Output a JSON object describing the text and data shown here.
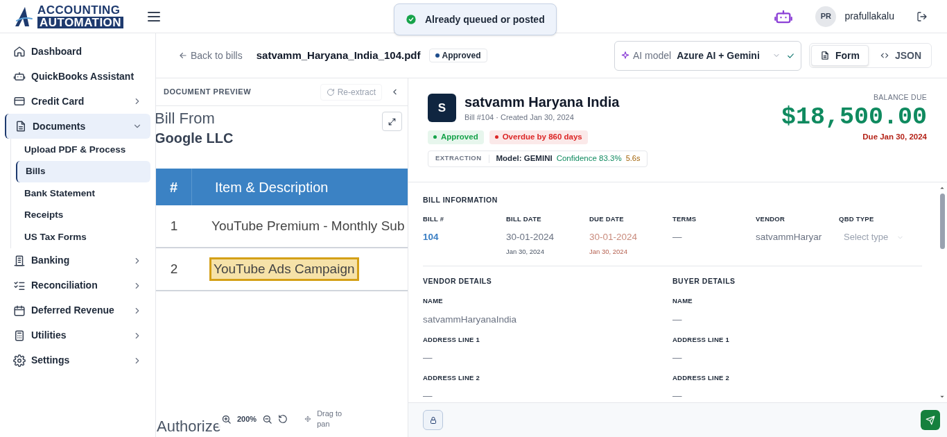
{
  "header": {
    "logo_lines": [
      "ACCOUNTING",
      "AUTOMATION"
    ],
    "toast": "Already queued or posted",
    "user_initials": "PR",
    "username": "prafullakalu"
  },
  "sidebar": {
    "items": [
      {
        "label": "Dashboard",
        "selected": false
      },
      {
        "label": "QuickBooks Assistant",
        "selected": false
      },
      {
        "label": "Credit Card",
        "selected": false,
        "expanded": false
      },
      {
        "label": "Documents",
        "selected": true,
        "expanded": true,
        "children": [
          {
            "label": "Upload PDF & Process",
            "selected": false
          },
          {
            "label": "Bills",
            "selected": true
          },
          {
            "label": "Bank Statement",
            "selected": false
          },
          {
            "label": "Receipts",
            "selected": false
          },
          {
            "label": "US Tax Forms",
            "selected": false
          }
        ]
      },
      {
        "label": "Banking",
        "selected": false,
        "expanded": false
      },
      {
        "label": "Reconciliation",
        "selected": false,
        "expanded": false
      },
      {
        "label": "Deferred Revenue",
        "selected": false,
        "expanded": false
      },
      {
        "label": "Utilities",
        "selected": false,
        "expanded": false
      },
      {
        "label": "Settings",
        "selected": false,
        "expanded": false
      }
    ]
  },
  "toolbar": {
    "back": "Back to bills",
    "filename": "satvamm_Haryana_India_104.pdf",
    "status": {
      "label": "Approved",
      "color": "#1e4d8c"
    },
    "ai_model": {
      "label": "AI model",
      "value": "Azure AI + Gemini"
    },
    "views": [
      {
        "label": "Form",
        "selected": true
      },
      {
        "label": "JSON",
        "selected": false
      }
    ]
  },
  "preview": {
    "title": "DOCUMENT PREVIEW",
    "reextract": "Re-extract",
    "document": {
      "heading": "Bill From",
      "company": "Google LLC",
      "columns": [
        "#",
        "Item & Description"
      ],
      "rows": [
        {
          "number": "1",
          "description": "YouTube Premium - Monthly Sub",
          "highlighted": false
        },
        {
          "number": "2",
          "description": "YouTube Ads Campaign",
          "highlighted": true
        }
      ],
      "footer": "Authorize"
    },
    "zoom": "200%",
    "pan_hint": "Drag to pan"
  },
  "bill": {
    "avatar": "S",
    "name": "satvamm Haryana India",
    "subtitle": "Bill #104 · Created Jan 30, 2024",
    "badges": [
      {
        "label": "Approved",
        "color": "#16a34a"
      },
      {
        "label": "Overdue by 860 days",
        "color": "#dc2626"
      }
    ],
    "extraction": {
      "label": "EXTRACTION",
      "model": "Model: GEMINI",
      "confidence": "Confidence 83.3%",
      "time": "5.6s"
    },
    "balance": {
      "label": "BALANCE DUE",
      "amount": "$18,500.00",
      "due": "Due Jan 30, 2024"
    }
  },
  "bill_information": {
    "title": "BILL INFORMATION",
    "fields": [
      {
        "kind": "link",
        "label": "BILL #",
        "value": "104"
      },
      {
        "kind": "date",
        "label": "BILL DATE",
        "value": "30-01-2024",
        "sub": "Jan 30, 2024"
      },
      {
        "kind": "overdue",
        "label": "DUE DATE",
        "value": "30-01-2024",
        "sub": "Jan 30, 2024"
      },
      {
        "kind": "empty",
        "label": "TERMS",
        "value": "—"
      },
      {
        "kind": "text",
        "label": "VENDOR",
        "value": "satvammHaryar"
      },
      {
        "kind": "select",
        "label": "QBD TYPE",
        "placeholder": "Select type"
      }
    ]
  },
  "details": [
    {
      "title": "VENDOR DETAILS",
      "fields": [
        {
          "label": "NAME",
          "value": "satvammHaryanaIndia"
        },
        {
          "label": "ADDRESS LINE 1",
          "value": "—"
        },
        {
          "label": "ADDRESS LINE 2",
          "value": "—"
        }
      ]
    },
    {
      "title": "BUYER DETAILS",
      "fields": [
        {
          "label": "NAME",
          "value": "—"
        },
        {
          "label": "ADDRESS LINE 1",
          "value": "—"
        },
        {
          "label": "ADDRESS LINE 2",
          "value": "—"
        }
      ]
    }
  ]
}
